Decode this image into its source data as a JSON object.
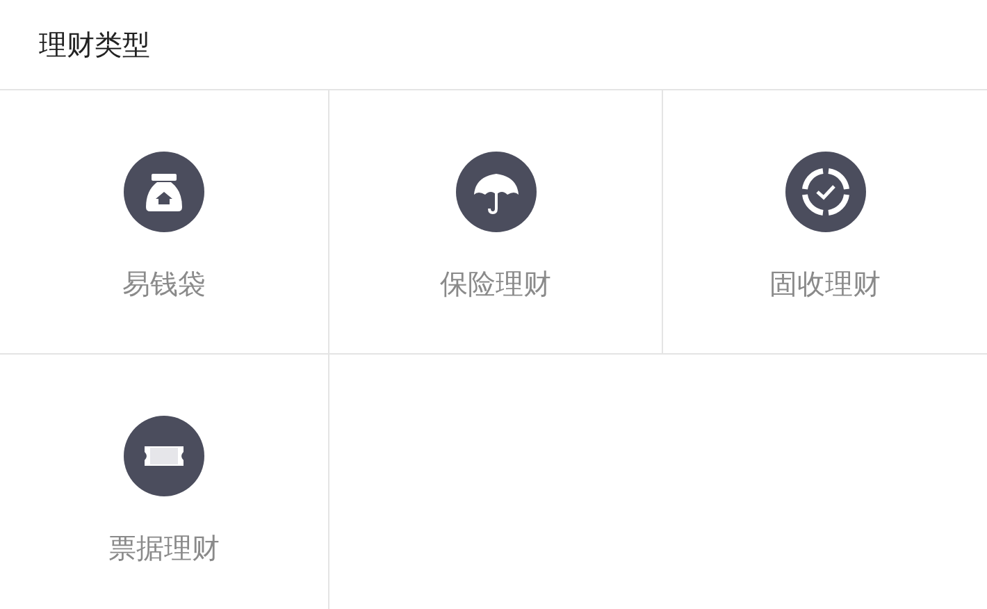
{
  "title": "理财类型",
  "items": [
    {
      "label": "易钱袋",
      "kind": "bag"
    },
    {
      "label": "保险理财",
      "kind": "umbrella"
    },
    {
      "label": "固收理财",
      "kind": "target"
    },
    {
      "label": "票据理财",
      "kind": "ticket"
    }
  ]
}
